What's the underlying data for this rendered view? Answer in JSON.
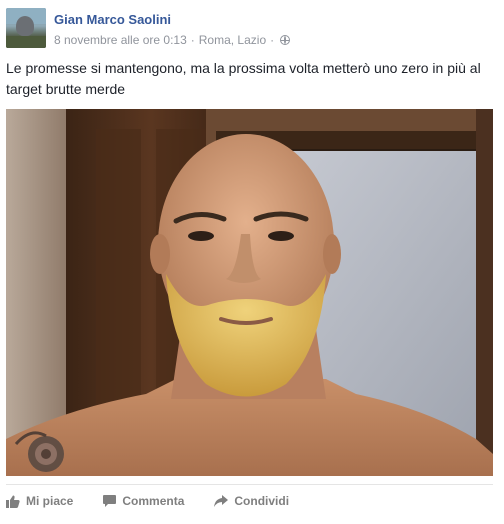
{
  "post": {
    "author": "Gian Marco Saolini",
    "date": "8 novembre alle ore 0:13",
    "separator1": "·",
    "location": "Roma, Lazio",
    "separator2": "·",
    "privacy_icon": "globe-icon",
    "text": "Le promesse si mantengono, ma la prossima volta metterò uno zero in più al target brutte merde"
  },
  "actions": {
    "like_label": "Mi piace",
    "comment_label": "Commenta",
    "share_label": "Condividi",
    "like_icon": "thumbs-up-icon",
    "comment_icon": "comment-bubble-icon",
    "share_icon": "share-arrow-icon"
  },
  "colors": {
    "author_link": "#365899",
    "meta_text": "#90949c",
    "action_text": "#7f7f7f"
  }
}
